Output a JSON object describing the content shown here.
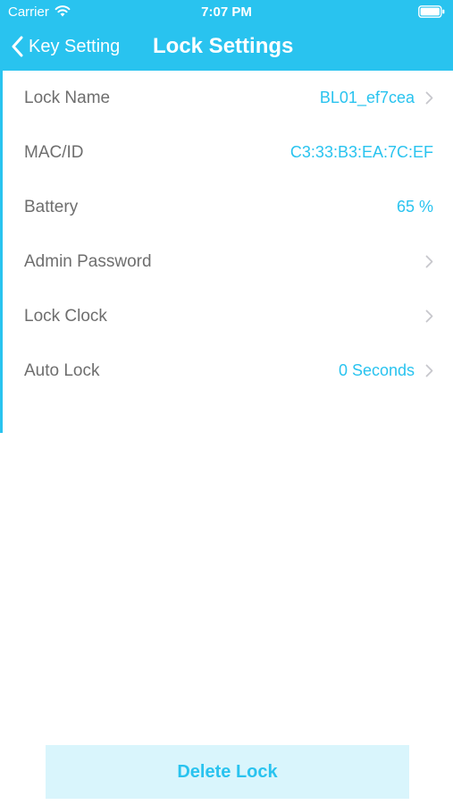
{
  "status_bar": {
    "carrier": "Carrier",
    "time": "7:07 PM"
  },
  "nav": {
    "back_label": "Key Setting",
    "title": "Lock Settings"
  },
  "settings": [
    {
      "label": "Lock Name",
      "value": "BL01_ef7cea",
      "chevron": true
    },
    {
      "label": "MAC/ID",
      "value": "C3:33:B3:EA:7C:EF",
      "chevron": false
    },
    {
      "label": "Battery",
      "value": "65 %",
      "chevron": false
    },
    {
      "label": "Admin Password",
      "value": "",
      "chevron": true
    },
    {
      "label": "Lock Clock",
      "value": "",
      "chevron": true
    },
    {
      "label": "Auto Lock",
      "value": "0 Seconds",
      "chevron": true
    }
  ],
  "delete_button": {
    "label": "Delete Lock"
  },
  "icons": {
    "wifi": "wifi-icon",
    "battery": "battery-icon",
    "back": "chevron-left-icon",
    "row_chevron": "chevron-right-icon"
  },
  "colors": {
    "accent": "#29c3ef",
    "label_text": "#6e6e6e",
    "chevron": "#c7c7cc",
    "delete_background": "#d9f5fc"
  }
}
